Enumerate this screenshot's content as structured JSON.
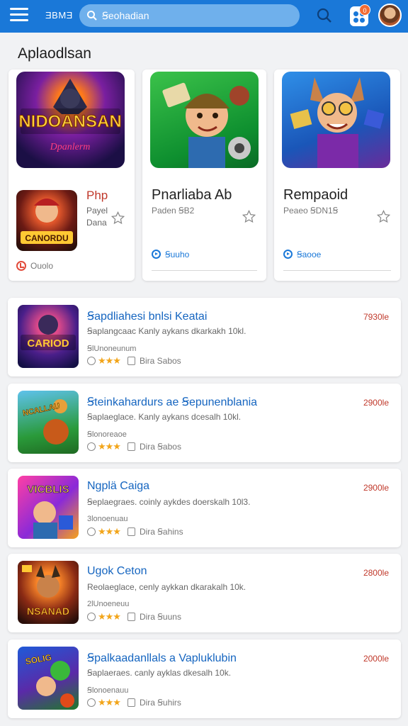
{
  "header": {
    "brand": "ƎBMƎ",
    "search_value": "Ꞩeohadian",
    "notification_count": "0"
  },
  "section": {
    "title": "Aplaodlsan"
  },
  "featured": [
    {
      "art_text": "NIDOANSAN",
      "art_subtext": "Dpanlerm",
      "mini_title": "Php",
      "mini_sub1": "Payel",
      "mini_sub2": "Dana",
      "mini_art_text": "CANORDU",
      "action": "Ouolo"
    },
    {
      "title": "Pnarliaba Ab",
      "subtitle": "Paden ꞨB2",
      "action": "Ꞩuuho"
    },
    {
      "title": "Rempaoid",
      "subtitle": "Peaeo ꞨDN1Ꞩ",
      "action": "Ꞩaooe"
    }
  ],
  "list": [
    {
      "title": "Ꞩapdliahesi bnlsi Keatai",
      "desc": "Ꞩaplangcaac Kanly aykans dkarkakh 10kl.",
      "sub": "ꞨlUnoneunum",
      "tag": "Bira Sabos",
      "price": "7930le",
      "art_text": "CARIOD"
    },
    {
      "title": "Ꞩteinkahardurs ae Ꞩepunenblania",
      "desc": "Ꞩaplaeglace. Kanly aykans dcesalh 10kl.",
      "sub": "Ꞩlonoreaoe",
      "tag": "Dira Ꞩabos",
      "price": "2900le",
      "art_text": "NCALLAU"
    },
    {
      "title": "Ngplä Caiga",
      "desc": "Ꞩeplaegraes. coinly aykdes doerskalh 10l3.",
      "sub": "3lonoenuau",
      "tag": "Dira Ꞩahins",
      "price": "2900le",
      "art_text": "VICBLIS"
    },
    {
      "title": "Ugok Ceton",
      "desc": "Reolaeglace, cenly aykkan dkarakalh 10k.",
      "sub": "2lUnoeneuu",
      "tag": "Dira Ꞩuuns",
      "price": "2800le",
      "art_text": "NSANAD"
    },
    {
      "title": "Ꞩpalkaadanllals a Vapluklubin",
      "desc": "Ꞩaplaeraes. canly ayklas dkesalh 10k.",
      "sub": "Ꞩlonoenauu",
      "tag": "Dira Ꞩuhirs",
      "price": "2000le",
      "art_text": "SOLIG"
    }
  ],
  "colors": {
    "topbar": "#1a78d8",
    "list_title": "#1565c0",
    "price": "#c0392b",
    "star": "#f2a51a"
  }
}
